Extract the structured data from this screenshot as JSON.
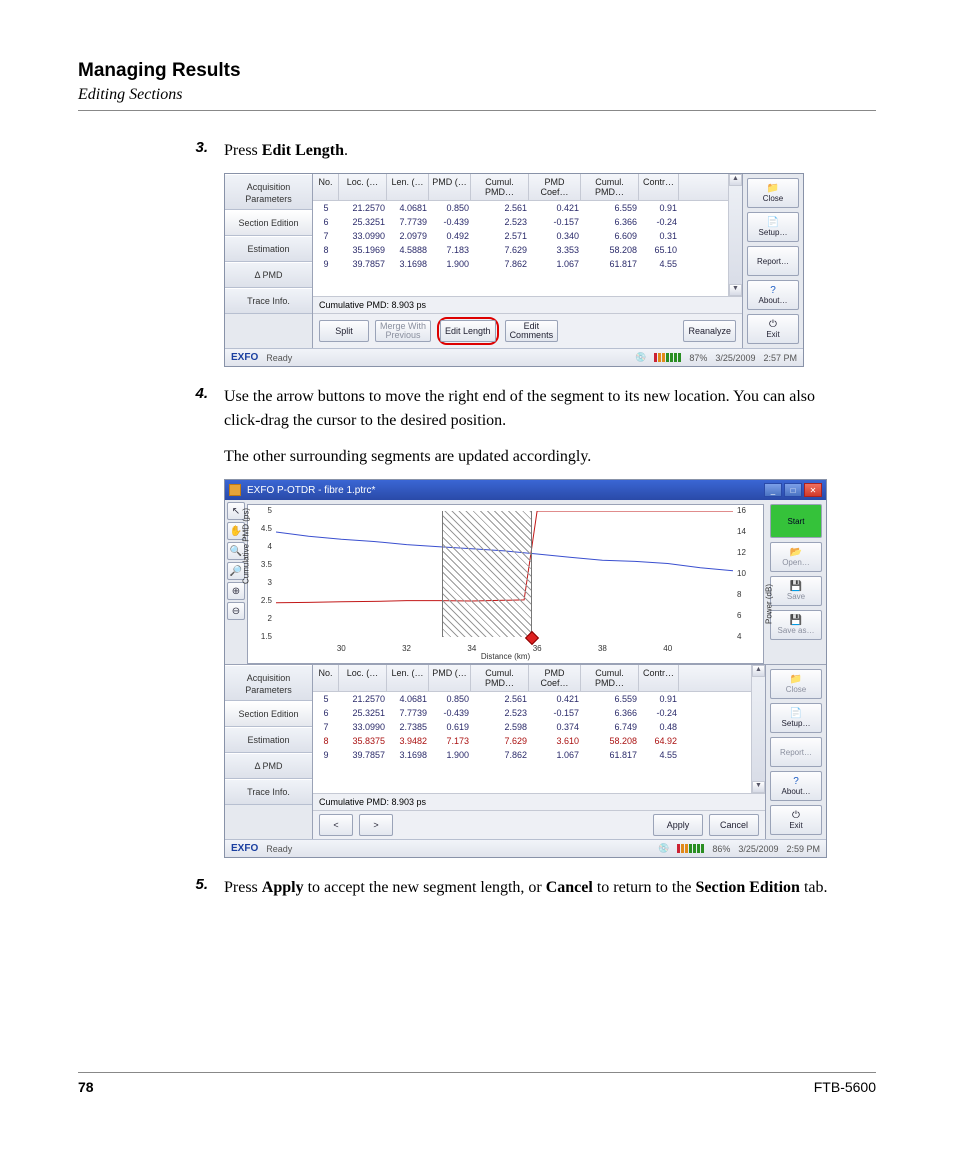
{
  "page": {
    "title": "Managing Results",
    "subtitle": "Editing Sections",
    "page_number": "78",
    "model": "FTB-5600"
  },
  "steps": {
    "s3_num": "3.",
    "s3_a": "Press ",
    "s3_b": "Edit Length",
    "s3_c": ".",
    "s4_num": "4.",
    "s4_a": "Use the arrow buttons to move the right end of the segment to its new location. You can also click-drag the cursor to the desired position.",
    "s4_b": "The other surrounding segments are updated accordingly.",
    "s5_num": "5.",
    "s5_a": "Press ",
    "s5_b": "Apply",
    "s5_c": " to accept the new segment length, or ",
    "s5_d": "Cancel",
    "s5_e": " to return to the ",
    "s5_f": "Section Edition",
    "s5_g": " tab."
  },
  "tabs": {
    "acq": "Acquisition\nParameters",
    "section": "Section Edition",
    "estim": "Estimation",
    "dpmd": "Δ PMD",
    "trace": "Trace Info."
  },
  "table": {
    "headers": {
      "no": "No.",
      "loc": "Loc. (…",
      "len": "Len. (…",
      "pmd": "PMD (…",
      "cpmd1": "Cumul. PMD…",
      "coef": "PMD Coef…",
      "cpmd2": "Cumul. PMD…",
      "contr": "Contr…"
    },
    "rows1": [
      {
        "no": "5",
        "loc": "21.2570",
        "len": "4.0681",
        "pmd": "0.850",
        "cpmd1": "2.561",
        "coef": "0.421",
        "cpmd2": "6.559",
        "contr": "0.91",
        "red": false
      },
      {
        "no": "6",
        "loc": "25.3251",
        "len": "7.7739",
        "pmd": "-0.439",
        "cpmd1": "2.523",
        "coef": "-0.157",
        "cpmd2": "6.366",
        "contr": "-0.24",
        "red": false
      },
      {
        "no": "7",
        "loc": "33.0990",
        "len": "2.0979",
        "pmd": "0.492",
        "cpmd1": "2.571",
        "coef": "0.340",
        "cpmd2": "6.609",
        "contr": "0.31",
        "red": false
      },
      {
        "no": "8",
        "loc": "35.1969",
        "len": "4.5888",
        "pmd": "7.183",
        "cpmd1": "7.629",
        "coef": "3.353",
        "cpmd2": "58.208",
        "contr": "65.10",
        "red": false
      },
      {
        "no": "9",
        "loc": "39.7857",
        "len": "3.1698",
        "pmd": "1.900",
        "cpmd1": "7.862",
        "coef": "1.067",
        "cpmd2": "61.817",
        "contr": "4.55",
        "red": false
      }
    ],
    "rows2": [
      {
        "no": "5",
        "loc": "21.2570",
        "len": "4.0681",
        "pmd": "0.850",
        "cpmd1": "2.561",
        "coef": "0.421",
        "cpmd2": "6.559",
        "contr": "0.91",
        "red": false
      },
      {
        "no": "6",
        "loc": "25.3251",
        "len": "7.7739",
        "pmd": "-0.439",
        "cpmd1": "2.523",
        "coef": "-0.157",
        "cpmd2": "6.366",
        "contr": "-0.24",
        "red": false
      },
      {
        "no": "7",
        "loc": "33.0990",
        "len": "2.7385",
        "pmd": "0.619",
        "cpmd1": "2.598",
        "coef": "0.374",
        "cpmd2": "6.749",
        "contr": "0.48",
        "red": false
      },
      {
        "no": "8",
        "loc": "35.8375",
        "len": "3.9482",
        "pmd": "7.173",
        "cpmd1": "7.629",
        "coef": "3.610",
        "cpmd2": "58.208",
        "contr": "64.92",
        "red": true
      },
      {
        "no": "9",
        "loc": "39.7857",
        "len": "3.1698",
        "pmd": "1.900",
        "cpmd1": "7.862",
        "coef": "1.067",
        "cpmd2": "61.817",
        "contr": "4.55",
        "red": false
      }
    ],
    "cumul_label": "Cumulative PMD: 8.903 ps"
  },
  "bottom_btns1": {
    "split": "Split",
    "merge": "Merge With\nPrevious",
    "edit_len": "Edit Length",
    "edit_comm": "Edit\nComments",
    "reanalyze": "Reanalyze"
  },
  "bottom_btns2": {
    "left": "<",
    "right": ">",
    "apply": "Apply",
    "cancel": "Cancel"
  },
  "right_btns": {
    "start": "Start",
    "open": "Open…",
    "save": "Save",
    "saveas": "Save as…",
    "close": "Close",
    "setup": "Setup…",
    "report": "Report…",
    "about": "About…",
    "exit": "Exit"
  },
  "status": {
    "brand": "EXFO",
    "state": "Ready",
    "pct1": "87%",
    "pct2": "86%",
    "date": "3/25/2009",
    "time1": "2:57 PM",
    "time2": "2:59 PM"
  },
  "titlebar": {
    "text": "EXFO P-OTDR - fibre 1.ptrc*"
  },
  "chart_data": {
    "type": "line",
    "xlabel": "Distance (km)",
    "ylabel_left": "Cumulative PMD (ps)",
    "ylabel_right": "Power (dB)",
    "xlim": [
      28,
      42
    ],
    "ylim_left": [
      1.5,
      5
    ],
    "ylim_right": [
      4,
      16
    ],
    "xticks": [
      30,
      32,
      34,
      36,
      38,
      40
    ],
    "yticks_left": [
      1.5,
      2,
      2.5,
      3,
      3.5,
      4,
      4.5,
      5
    ],
    "yticks_right": [
      4,
      6,
      8,
      10,
      12,
      14,
      16
    ],
    "selection_band_x": [
      33.1,
      35.84
    ],
    "cursor_x": 35.84,
    "series": [
      {
        "name": "Cumulative PMD",
        "axis": "left",
        "color": "#c21818",
        "x": [
          28,
          29,
          30,
          31,
          32,
          33,
          34,
          35,
          35.6,
          36,
          37,
          38,
          39,
          40,
          41,
          42
        ],
        "y": [
          2.45,
          2.46,
          2.48,
          2.49,
          2.51,
          2.51,
          2.5,
          2.52,
          2.53,
          5.0,
          5.0,
          5.0,
          5.0,
          5.0,
          5.0,
          5.0
        ]
      },
      {
        "name": "Power",
        "axis": "right",
        "color": "#3a4fcf",
        "x": [
          28,
          29,
          30,
          31,
          32,
          33,
          34,
          35,
          36,
          37,
          38,
          39,
          40,
          41,
          42
        ],
        "y": [
          14.0,
          13.6,
          13.3,
          13.1,
          12.8,
          12.6,
          12.4,
          12.2,
          11.9,
          11.6,
          11.3,
          11.2,
          11.0,
          10.6,
          10.3
        ]
      }
    ]
  },
  "tool_icons": [
    "↖",
    "✋",
    "🔍",
    "🔎",
    "⊕",
    "⊖"
  ]
}
